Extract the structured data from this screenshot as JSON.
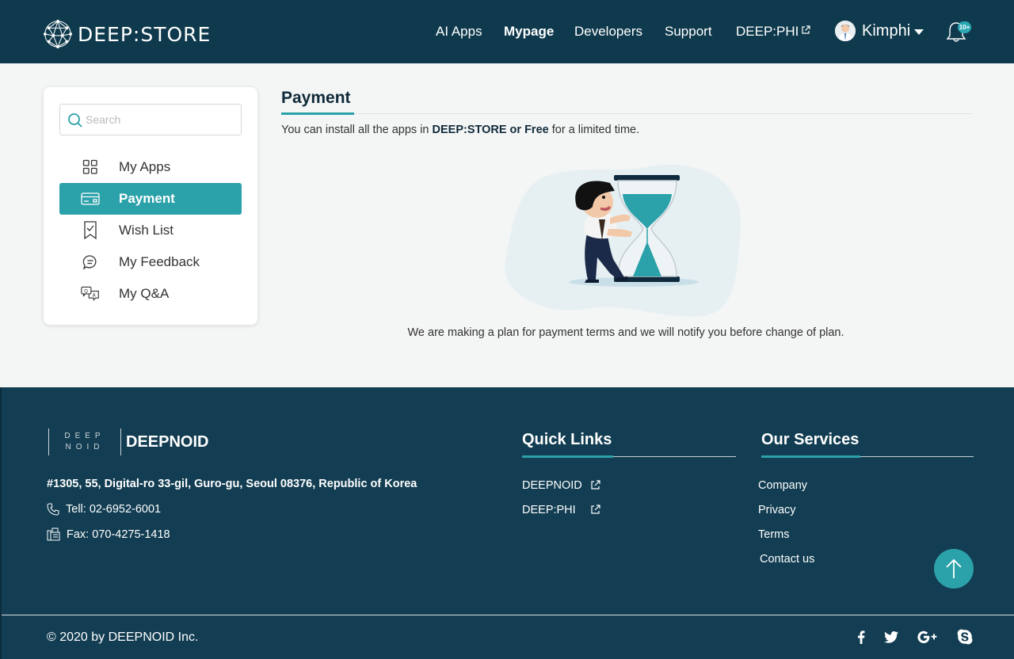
{
  "header": {
    "logo_text": "DEEP:STORE",
    "nav": [
      {
        "label": "AI Apps",
        "active": false
      },
      {
        "label": "Mypage",
        "active": true
      },
      {
        "label": "Developers",
        "active": false
      },
      {
        "label": "Support",
        "active": false
      },
      {
        "label": "DEEP:PHI",
        "active": false,
        "external": true
      }
    ],
    "user_name": "Kimphi",
    "notification_badge": "10+"
  },
  "sidebar": {
    "search_placeholder": "Search",
    "search_value": "",
    "items": [
      {
        "label": "My Apps",
        "icon": "grid-icon",
        "active": false
      },
      {
        "label": "Payment",
        "icon": "credit-card-icon",
        "active": true
      },
      {
        "label": "Wish List",
        "icon": "bookmark-check-icon",
        "active": false
      },
      {
        "label": "My Feedback",
        "icon": "chat-bubble-icon",
        "active": false
      },
      {
        "label": "My Q&A",
        "icon": "qa-chat-icon",
        "active": false
      }
    ]
  },
  "main": {
    "title": "Payment",
    "desc_prefix": "You can install all the apps in ",
    "desc_bold": "DEEP:STORE or Free",
    "desc_suffix": " for a limited time.",
    "notice": "We are making a plan for payment terms and we will notify you before change of plan."
  },
  "footer": {
    "logo_box_top": "DEEP",
    "logo_box_bottom": "NOID",
    "company_name": "DEEPNOID",
    "address": "#1305, 55, Digital-ro 33-gil, Guro-gu, Seoul 08376, Republic of Korea",
    "tel": "Tell: 02-6952-6001",
    "fax": "Fax: 070-4275-1418",
    "quick_links_title": "Quick Links",
    "quick_links": [
      "DEEPNOID",
      "DEEP:PHI"
    ],
    "services_title": "Our Services",
    "services": [
      "Company",
      "Privacy",
      "Terms",
      "Contact us"
    ],
    "copyright": "© 2020 by DEEPNOID Inc.",
    "social": [
      "facebook-icon",
      "twitter-icon",
      "google-plus-icon",
      "skype-icon"
    ]
  },
  "colors": {
    "header_bg": "#0f3a4d",
    "footer_bg": "#123d52",
    "accent": "#2ba1a9",
    "page_bg": "#f4f5f5"
  }
}
